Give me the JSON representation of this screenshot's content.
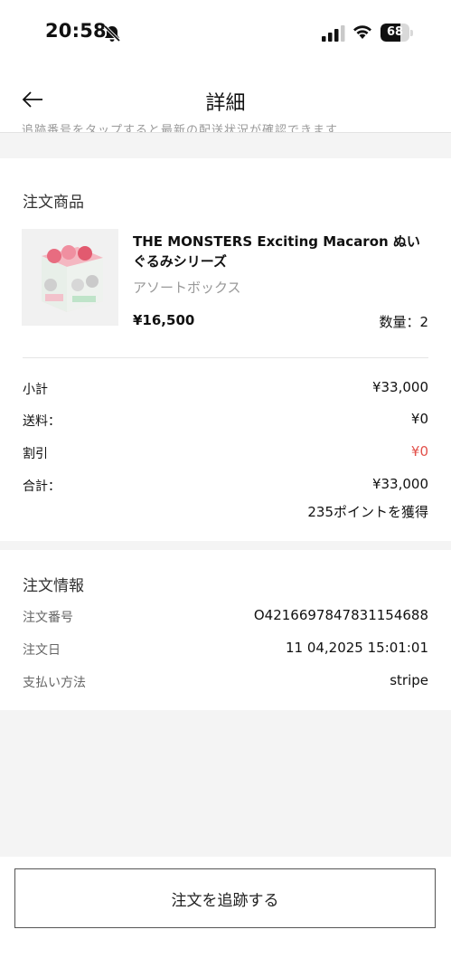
{
  "status_bar": {
    "time": "20:58",
    "battery_level": "68",
    "battery_fraction": 0.68,
    "icons": [
      "bell-slash-icon",
      "cellular-signal-icon",
      "wifi-icon",
      "battery-icon"
    ]
  },
  "header": {
    "title": "詳細",
    "back_icon": "arrow-left-icon",
    "cut_text": "追跡番号をタップすると最新の配送状況が確認できます"
  },
  "order_items": {
    "title": "注文商品",
    "product": {
      "name": "THE MONSTERS Exciting Macaron ぬいぐるみシリーズ",
      "variant": "アソートボックス",
      "price": "¥16,500",
      "quantity": "数量：2"
    },
    "subtotal": {
      "label": "小計",
      "value": "¥33,000"
    },
    "shipping": {
      "label": "送料：",
      "value": "¥0"
    },
    "discount": {
      "label": "割引",
      "value": "¥0"
    },
    "total": {
      "label": "合計：",
      "value": "¥33,000"
    },
    "points": "235ポイントを獲得"
  },
  "order_info": {
    "title": "注文情報",
    "order_number": {
      "label": "注文番号",
      "value": "O421669784783115468​8"
    },
    "order_date": {
      "label": "注文日",
      "value": "11 04,2025 15:01:01"
    },
    "payment_method": {
      "label": "支払い方法",
      "value": "stripe"
    }
  },
  "actions": {
    "track_button": "注文を追跡する"
  },
  "colors": {
    "accent_red": "#e2504a",
    "background_gray": "#f4f4f4",
    "muted_text": "#999999"
  }
}
